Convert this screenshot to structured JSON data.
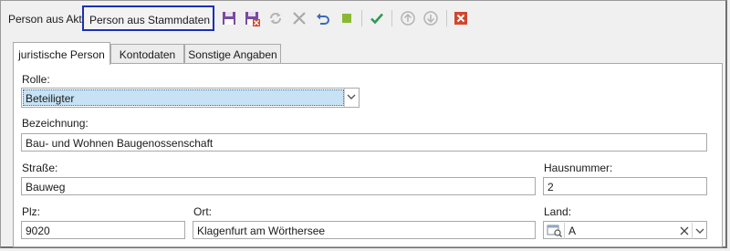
{
  "toolbar": {
    "person_aus_akt": "Person aus Akt",
    "person_aus_stammdaten": "Person aus Stammdaten"
  },
  "tabs": [
    {
      "label": "juristische Person"
    },
    {
      "label": "Kontodaten"
    },
    {
      "label": "Sonstige Angaben"
    }
  ],
  "form": {
    "rolle": {
      "label": "Rolle:",
      "value": "Beteiligter"
    },
    "bezeichnung": {
      "label": "Bezeichnung:",
      "value": "Bau- und Wohnen Baugenossenschaft"
    },
    "strasse": {
      "label": "Straße:",
      "value": "Bauweg"
    },
    "hausnummer": {
      "label": "Hausnummer:",
      "value": "2"
    },
    "plz": {
      "label": "Plz:",
      "value": "9020"
    },
    "ort": {
      "label": "Ort:",
      "value": "Klagenfurt am Wörthersee"
    },
    "land": {
      "label": "Land:",
      "value": "A"
    }
  },
  "colors": {
    "accent_border": "#1c2fb5",
    "selection_bg": "#c6e2f4",
    "save_icon": "#7a4aa0",
    "check_icon": "#2f9a55",
    "close_icon": "#d0472f",
    "stop_icon": "#8bb833",
    "undo_icon": "#3a6cb5"
  },
  "icons": [
    "save-icon",
    "save-close-icon",
    "refresh-icon",
    "cancel-icon",
    "undo-icon",
    "stop-icon",
    "check-icon",
    "arrow-up-icon",
    "arrow-down-icon",
    "close-icon",
    "lookup-icon",
    "clear-icon",
    "chevron-down-icon"
  ]
}
